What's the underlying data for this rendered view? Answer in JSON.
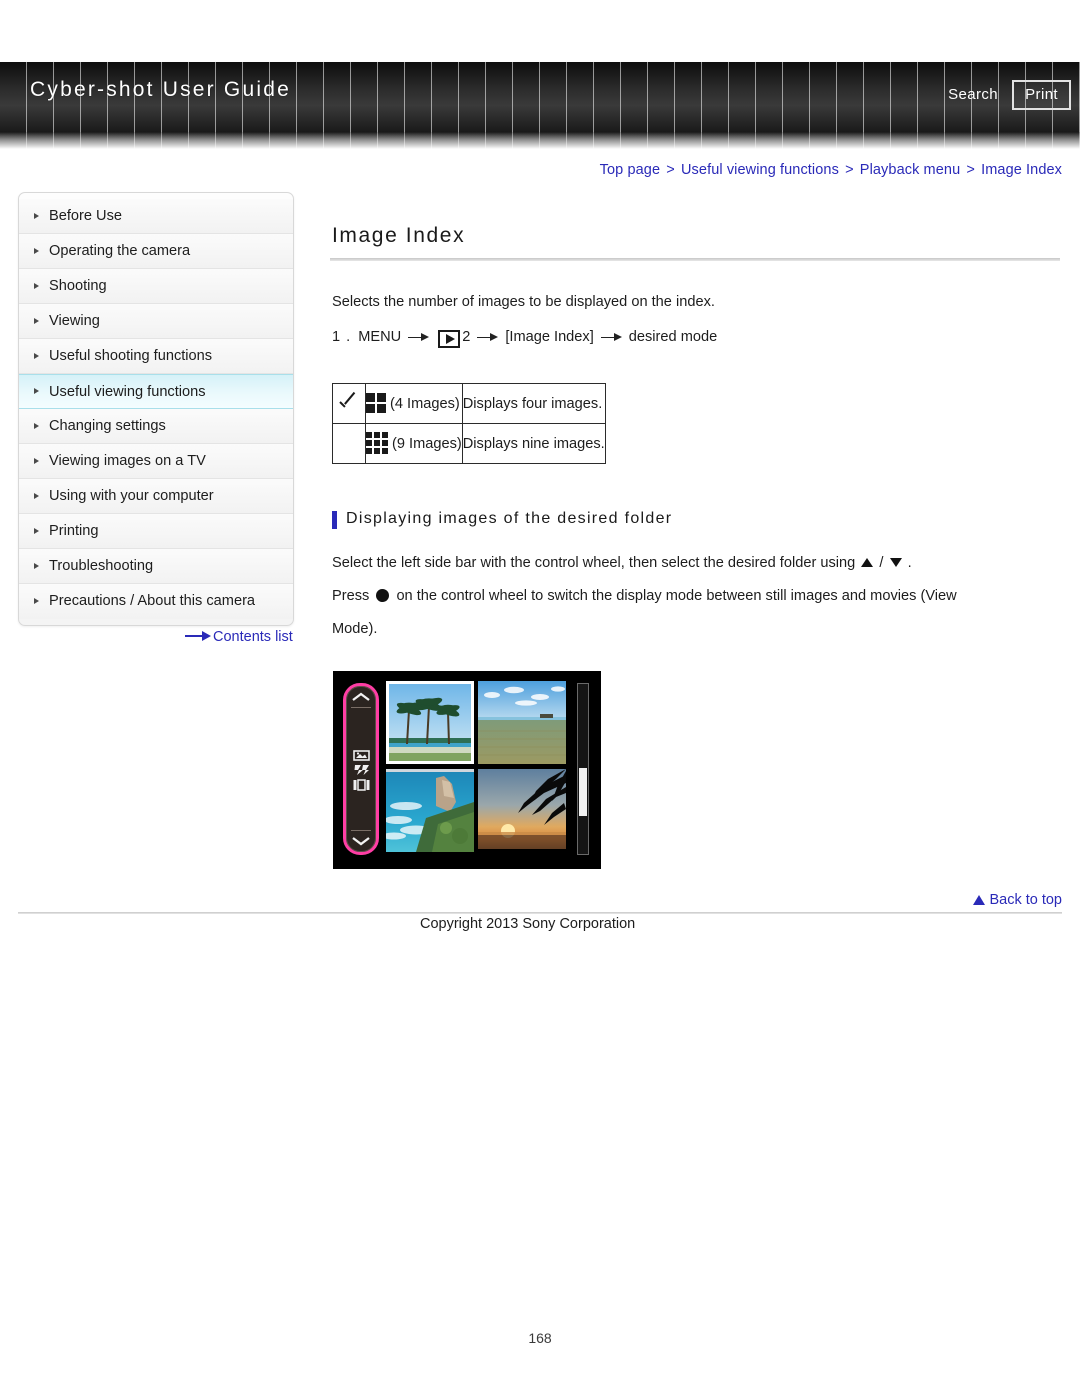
{
  "header": {
    "site_title": "Cyber-shot User Guide",
    "search_label": "Search",
    "print_label": "Print"
  },
  "breadcrumb": {
    "separator": ">",
    "items": [
      {
        "label": "Top page"
      },
      {
        "label": "Useful viewing functions"
      },
      {
        "label": "Playback menu"
      },
      {
        "label": "Image Index"
      }
    ]
  },
  "sidebar": {
    "items": [
      {
        "label": "Before Use",
        "active": false
      },
      {
        "label": "Operating the camera",
        "active": false
      },
      {
        "label": "Shooting",
        "active": false
      },
      {
        "label": "Viewing",
        "active": false
      },
      {
        "label": "Useful shooting functions",
        "active": false
      },
      {
        "label": "Useful viewing functions",
        "active": true
      },
      {
        "label": "Changing settings",
        "active": false
      },
      {
        "label": "Viewing images on a TV",
        "active": false
      },
      {
        "label": "Using with your computer",
        "active": false
      },
      {
        "label": "Printing",
        "active": false
      },
      {
        "label": "Troubleshooting",
        "active": false
      },
      {
        "label": "Precautions / About this camera",
        "active": false
      }
    ],
    "contents_list_label": "Contents list"
  },
  "main": {
    "title": "Image Index",
    "intro": "Selects the number of images to be displayed on the index.",
    "step": {
      "number": "1 .",
      "menu_label": "MENU",
      "playback_icon": "playback-icon",
      "menu_page": "2",
      "item_label": "[Image Index]",
      "result_label": "desired mode"
    },
    "options_table": {
      "rows": [
        {
          "checked": true,
          "icon": "grid-4-icon",
          "option": "(4 Images)",
          "description": "Displays four images."
        },
        {
          "checked": false,
          "icon": "grid-9-icon",
          "option": "(9 Images)",
          "description": "Displays nine images."
        }
      ]
    },
    "subsection": {
      "heading": "Displaying images of the desired folder",
      "line1_a": "Select the left side bar with the control wheel, then select the desired folder using",
      "line1_sep": "/",
      "line1_b": ".",
      "line2_a": "Press",
      "line2_b": "on the control wheel to switch the display mode between still images and movies (View",
      "line3": "Mode)."
    },
    "camera_screenshot": {
      "name": "camera-index-screen-illustration",
      "highlight_color": "#ff3ea5",
      "sidebar_icons": [
        "chevron-up-icon",
        "folder-image-icon",
        "movie-icon",
        "still-image-icon",
        "chevron-down-icon"
      ],
      "thumbnail_count": 4
    }
  },
  "footer": {
    "back_to_top": "Back to top",
    "copyright": "Copyright 2013 Sony Corporation",
    "page_number": "168"
  }
}
